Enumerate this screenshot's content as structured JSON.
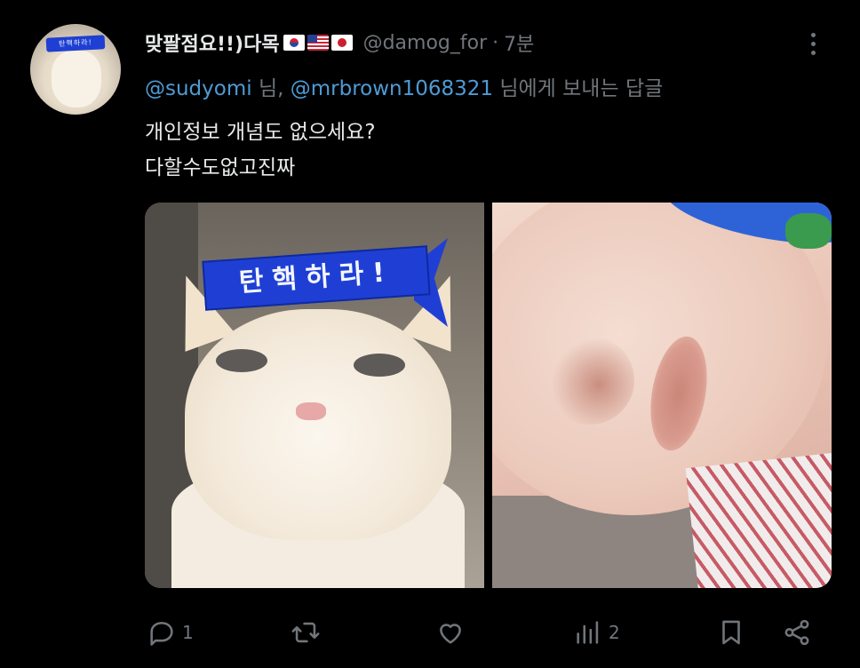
{
  "tweet": {
    "display_name": "맞팔점요!!)다목",
    "flags": [
      "kr-flag",
      "us-flag",
      "jp-flag"
    ],
    "handle": "@damog_for",
    "separator": "·",
    "time": "7분",
    "reply_to": {
      "mention1": "@sudyomi",
      "suffix1": " 님, ",
      "mention2": "@mrbrown1068321",
      "suffix2": " 님에게 보내는 답글"
    },
    "body_lines": [
      "개인정보 개념도 없으세요?",
      "다할수도없고진짜"
    ],
    "media": {
      "image1_headband_text": "탄핵하라!",
      "image2_description_icon": "face-closeup"
    },
    "avatar_headband_text": "탄핵하라!"
  },
  "actions": {
    "reply_count": "1",
    "retweet_count": "",
    "like_count": "",
    "views_count": "2"
  },
  "colors": {
    "background": "#000000",
    "text": "#e7e9ea",
    "muted": "#71767b",
    "mention": "#4e9bd5"
  }
}
